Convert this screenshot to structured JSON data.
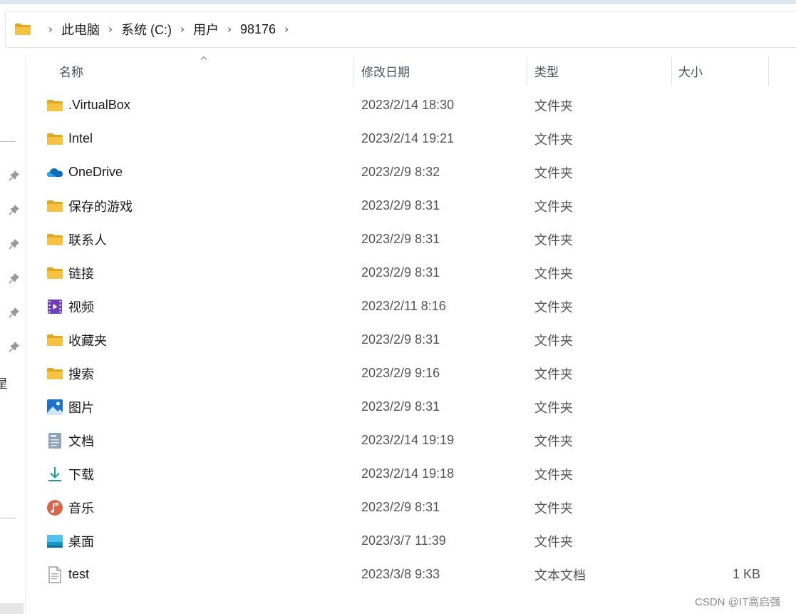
{
  "breadcrumb": {
    "items": [
      "此电脑",
      "系统 (C:)",
      "用户",
      "98176"
    ],
    "separator": "›"
  },
  "nav": {
    "cut_label": "星"
  },
  "columns": {
    "name": "名称",
    "date": "修改日期",
    "type": "类型",
    "size": "大小",
    "sort_indicator": "^"
  },
  "files": [
    {
      "name": ".VirtualBox",
      "icon": "folder-icon",
      "date": "2023/2/14 18:30",
      "type": "文件夹",
      "size": ""
    },
    {
      "name": "Intel",
      "icon": "folder-icon",
      "date": "2023/2/14 19:21",
      "type": "文件夹",
      "size": ""
    },
    {
      "name": "OneDrive",
      "icon": "onedrive-icon",
      "date": "2023/2/9 8:32",
      "type": "文件夹",
      "size": ""
    },
    {
      "name": "保存的游戏",
      "icon": "folder-icon",
      "date": "2023/2/9 8:31",
      "type": "文件夹",
      "size": ""
    },
    {
      "name": "联系人",
      "icon": "folder-icon",
      "date": "2023/2/9 8:31",
      "type": "文件夹",
      "size": ""
    },
    {
      "name": "链接",
      "icon": "folder-icon",
      "date": "2023/2/9 8:31",
      "type": "文件夹",
      "size": ""
    },
    {
      "name": "视频",
      "icon": "video-icon",
      "date": "2023/2/11 8:16",
      "type": "文件夹",
      "size": ""
    },
    {
      "name": "收藏夹",
      "icon": "folder-icon",
      "date": "2023/2/9 8:31",
      "type": "文件夹",
      "size": ""
    },
    {
      "name": "搜索",
      "icon": "folder-icon",
      "date": "2023/2/9 9:16",
      "type": "文件夹",
      "size": ""
    },
    {
      "name": "图片",
      "icon": "pictures-icon",
      "date": "2023/2/9 8:31",
      "type": "文件夹",
      "size": ""
    },
    {
      "name": "文档",
      "icon": "documents-icon",
      "date": "2023/2/14 19:19",
      "type": "文件夹",
      "size": ""
    },
    {
      "name": "下载",
      "icon": "download-icon",
      "date": "2023/2/14 19:18",
      "type": "文件夹",
      "size": ""
    },
    {
      "name": "音乐",
      "icon": "music-icon",
      "date": "2023/2/9 8:31",
      "type": "文件夹",
      "size": ""
    },
    {
      "name": "桌面",
      "icon": "desktop-icon",
      "date": "2023/3/7 11:39",
      "type": "文件夹",
      "size": ""
    },
    {
      "name": "test",
      "icon": "text-file-icon",
      "date": "2023/3/8 9:33",
      "type": "文本文档",
      "size": "1 KB"
    }
  ],
  "watermark": "CSDN @IT高启强",
  "colors": {
    "folder": "#f5c242",
    "folder_dark": "#e0a722",
    "onedrive": "#0f6cbd",
    "video": "#6b3fb8",
    "pictures": "#1b73c9",
    "download": "#1a9e8f",
    "music": "#d9654c",
    "desktop": "#1598c9"
  }
}
